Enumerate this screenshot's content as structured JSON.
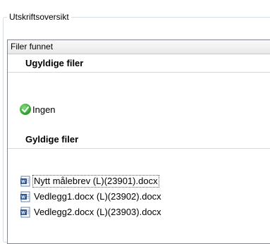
{
  "group": {
    "title": "Utskriftsoversikt"
  },
  "panel": {
    "header": "Filer funnet",
    "invalid_section": {
      "title": "Ugyldige filer",
      "status": "Ingen"
    },
    "valid_section": {
      "title": "Gyldige filer",
      "files": [
        "Nytt målebrev (L)(23901).docx",
        "Vedlegg1.docx (L)(23902).docx",
        "Vedlegg2.docx (L)(23903).docx"
      ]
    }
  },
  "icons": {
    "status": "check-circle-icon",
    "file": "word-document-icon"
  },
  "colors": {
    "check_green": "#2f9a2c",
    "word_blue": "#2b5797"
  }
}
